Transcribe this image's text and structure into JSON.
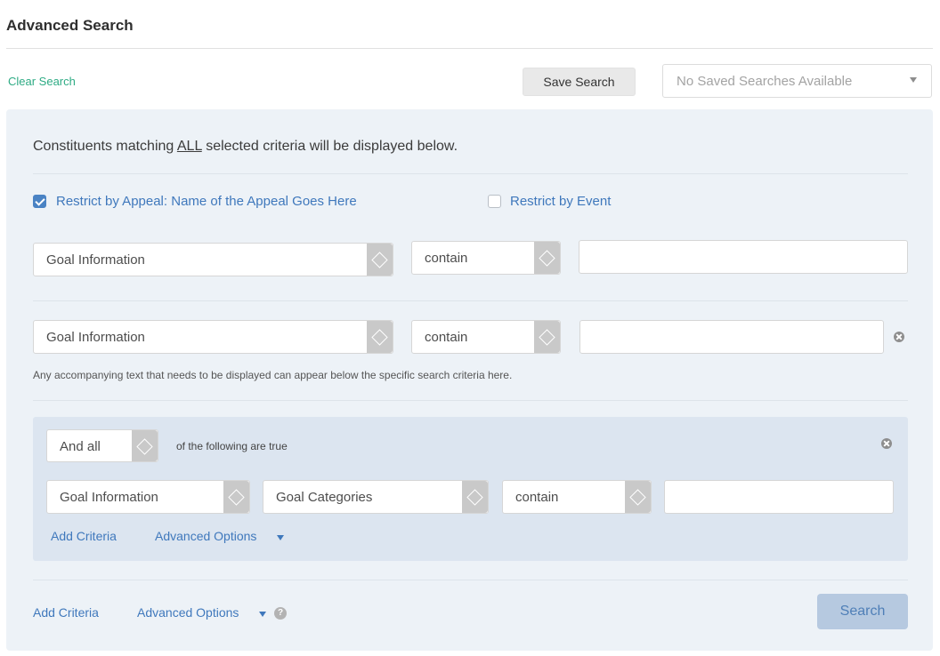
{
  "header": {
    "title": "Advanced Search",
    "clear_label": "Clear Search",
    "save_label": "Save Search",
    "saved_searches": "No Saved Searches Available"
  },
  "panel": {
    "intro_before": "Constituents matching ",
    "intro_emph": "ALL",
    "intro_after": " selected criteria will be displayed below.",
    "restrict_appeal": {
      "label": "Restrict by Appeal:",
      "value": "Name of the Appeal Goes Here",
      "checked": true
    },
    "restrict_event": {
      "label": "Restrict by Event",
      "checked": false
    },
    "rows": [
      {
        "field": "Goal Information",
        "operator": "contain",
        "value": ""
      },
      {
        "field": "Goal Information",
        "operator": "contain",
        "value": ""
      }
    ],
    "helper_text": "Any accompanying text that needs to be displayed can appear below the specific search criteria here.",
    "group": {
      "combinator": "And all",
      "suffix": "of the following are true",
      "row": {
        "field": "Goal Information",
        "subfield": "Goal Categories",
        "operator": "contain",
        "value": ""
      },
      "add_criteria": "Add Criteria",
      "advanced_options": "Advanced Options"
    },
    "footer": {
      "add_criteria": "Add Criteria",
      "advanced_options": "Advanced Options",
      "help_glyph": "?",
      "search_label": "Search"
    }
  },
  "colors": {
    "accent_blue": "#3f78bc",
    "clear_green": "#2eab84",
    "panel_bg": "#edf2f7",
    "group_bg": "#dce5f0",
    "search_btn_bg": "#b6c9e0"
  }
}
